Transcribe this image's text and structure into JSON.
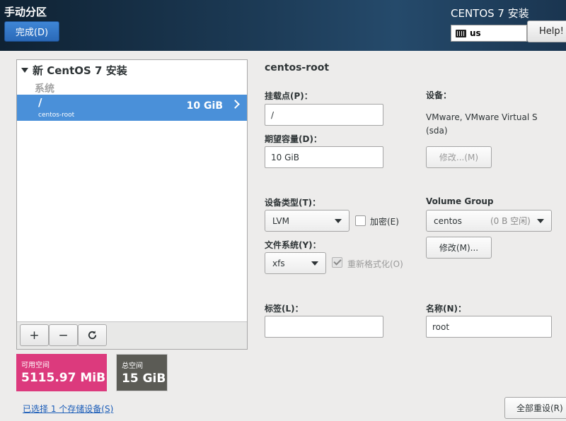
{
  "header": {
    "title": "手动分区",
    "done_label": "完成(D)",
    "product": "CENTOS 7 安装",
    "keyboard_layout": "us",
    "help_label": "Help!"
  },
  "partitions": {
    "install_title": "新 CentOS 7 安装",
    "section_label": "系统",
    "items": [
      {
        "mount": "/",
        "device": "centos-root",
        "size": "10 GiB",
        "selected": true
      }
    ],
    "toolbar": {
      "add": "+",
      "remove": "−",
      "refresh": "↻"
    }
  },
  "space": {
    "available_label": "可用空间",
    "available_value": "5115.97 MiB",
    "available_color": "#dc3a7d",
    "total_label": "总空间",
    "total_value": "15 GiB",
    "total_color": "#5b5b55"
  },
  "storage_link": "已选择 1 个存储设备(S)",
  "details": {
    "title": "centos-root",
    "mount_label": "挂载点(P)：",
    "mount_value": "/",
    "capacity_label": "期望容量(D)：",
    "capacity_value": "10 GiB",
    "device_label": "设备：",
    "device_value": "VMware, VMware Virtual S",
    "device_sub": "(sda)",
    "modify_device_label": "修改...(M)",
    "device_type_label": "设备类型(T)：",
    "device_type_value": "LVM",
    "encrypt_label": "加密(E)",
    "filesystem_label": "文件系统(Y)：",
    "filesystem_value": "xfs",
    "reformat_label": "重新格式化(O)",
    "vg_label": "Volume Group",
    "vg_value": "centos",
    "vg_free": "(0 B 空闲)",
    "modify_vg_label": "修改(M)...",
    "tag_label": "标签(L)：",
    "tag_value": "",
    "name_label": "名称(N)：",
    "name_value": "root"
  },
  "reset_label": "全部重设(R)"
}
